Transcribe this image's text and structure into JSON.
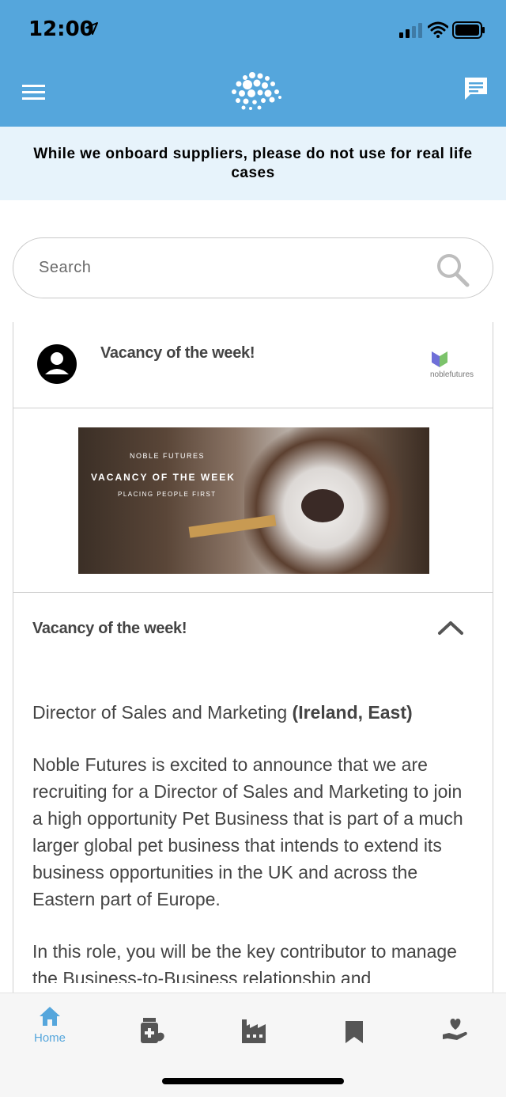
{
  "status_bar": {
    "time": "12:00"
  },
  "notice": {
    "text": "While we onboard suppliers, please do not use for real life cases"
  },
  "search": {
    "placeholder": "Search"
  },
  "card": {
    "title": "Vacancy of the week!",
    "brand_name": "noblefutures",
    "banner": {
      "line1": "NOBLE FUTURES",
      "line2": "VACANCY OF THE WEEK",
      "line3": "PLACING PEOPLE FIRST"
    },
    "section_title": "Vacancy of the week!",
    "job_title": "Director of Sales and Marketing",
    "job_region": "(Ireland, East)",
    "paragraph1": "Noble Futures is excited to announce that we are recruiting for a Director of Sales and Marketing to join a high opportunity Pet Business that is part of a much larger global pet business that intends to extend its business opportunities in the UK and across the Eastern part of Europe.",
    "paragraph2": "In this role, you will be the key contributor to manage the Business-to-Business relationship and"
  },
  "bottom_nav": {
    "items": [
      {
        "label": "Home",
        "icon": "home-icon",
        "active": true
      },
      {
        "label": "",
        "icon": "medicine-icon",
        "active": false
      },
      {
        "label": "",
        "icon": "factory-icon",
        "active": false
      },
      {
        "label": "",
        "icon": "bookmark-icon",
        "active": false
      },
      {
        "label": "",
        "icon": "care-hand-icon",
        "active": false
      }
    ]
  },
  "colors": {
    "header": "#55a6dc",
    "notice_bg": "#e7f3fb",
    "active_nav": "#55a6dc",
    "inactive_nav": "#555555"
  }
}
